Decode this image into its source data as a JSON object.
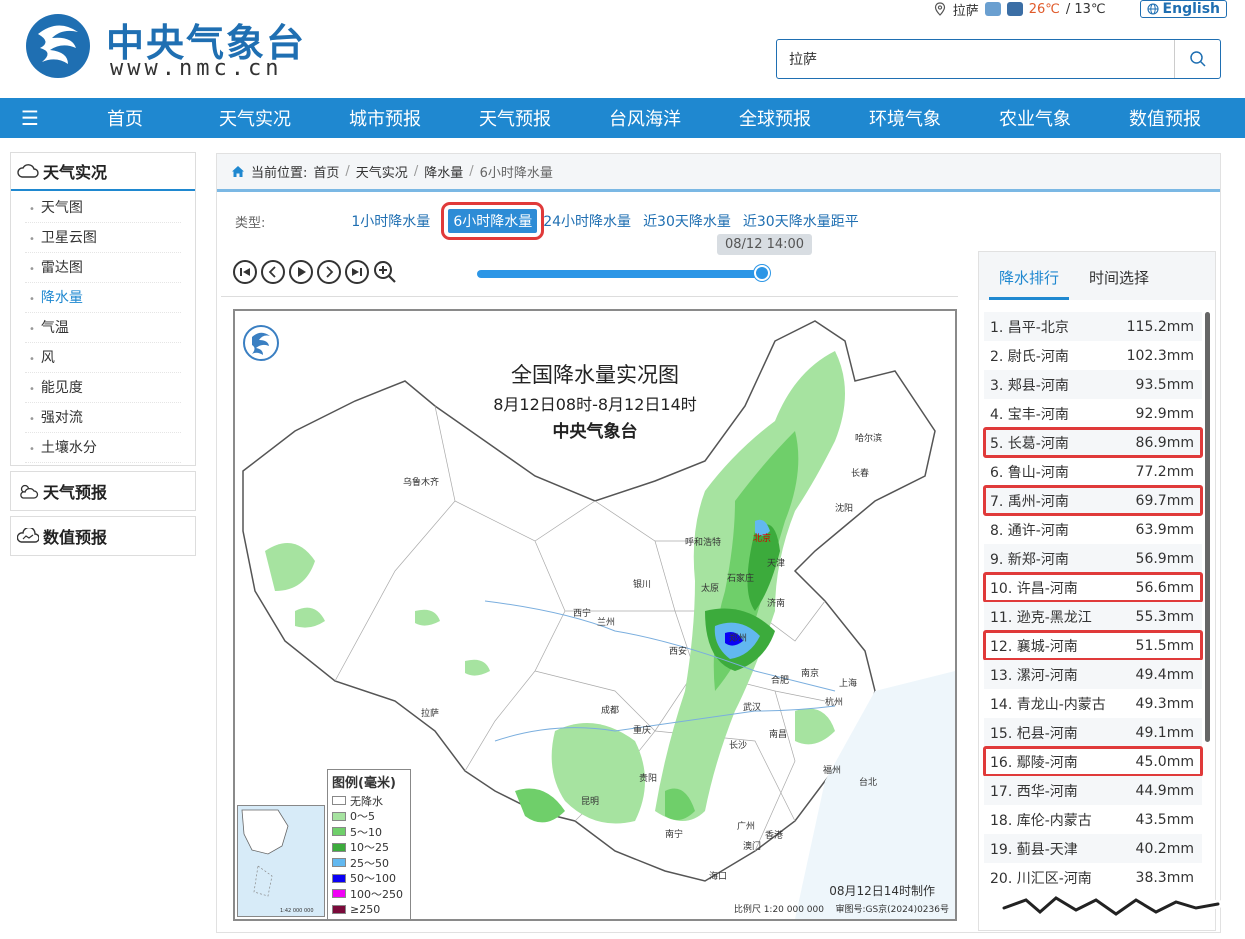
{
  "header": {
    "logo_cn": "中央气象台",
    "logo_url": "www.nmc.cn",
    "location": "拉萨",
    "temp_high": "26℃",
    "temp_low": " / 13℃",
    "english_label": "English",
    "search_value": "拉萨"
  },
  "nav": {
    "items": [
      "首页",
      "天气实况",
      "城市预报",
      "天气预报",
      "台风海洋",
      "全球预报",
      "环境气象",
      "农业气象",
      "数值预报"
    ]
  },
  "sidebar": {
    "section1": "天气实况",
    "items": [
      "天气图",
      "卫星云图",
      "雷达图",
      "降水量",
      "气温",
      "风",
      "能见度",
      "强对流",
      "土壤水分"
    ],
    "section2": "天气预报",
    "section3": "数值预报"
  },
  "breadcrumb": {
    "prefix": "当前位置:",
    "items": [
      "首页",
      "天气实况",
      "降水量",
      "6小时降水量"
    ]
  },
  "types": {
    "label": "类型:",
    "items": [
      "1小时降水量",
      "6小时降水量",
      "24小时降水量",
      "近30天降水量",
      "近30天降水量距平"
    ]
  },
  "player": {
    "timestamp": "08/12 14:00",
    "progress": 1.0
  },
  "map": {
    "title": "全国降水量实况图",
    "subtitle": "8月12日08时-8月12日14时",
    "org": "中央气象台",
    "made": "08月12日14时制作",
    "scale": "比例尺 1:20 000 000",
    "review": "审图号:GS京(2024)0236号",
    "inset_scale": "1:42 000 000",
    "cities": [
      "乌鲁木齐",
      "哈尔滨",
      "长春",
      "沈阳",
      "呼和浩特",
      "北京",
      "天津",
      "银川",
      "太原",
      "石家庄",
      "济南",
      "西宁",
      "兰州",
      "郑州",
      "西安",
      "合肥",
      "南京",
      "上海",
      "成都",
      "武汉",
      "杭州",
      "重庆",
      "长沙",
      "南昌",
      "拉萨",
      "贵阳",
      "福州",
      "台北",
      "昆明",
      "广州",
      "南宁",
      "澳门",
      "香港",
      "海口"
    ],
    "legend": {
      "title": "图例(毫米)",
      "items": [
        {
          "label": "无降水",
          "color": "#ffffff"
        },
        {
          "label": "0～5",
          "color": "#a6e3a0"
        },
        {
          "label": "5～10",
          "color": "#6fcf6a"
        },
        {
          "label": "10～25",
          "color": "#3cab3c"
        },
        {
          "label": "25～50",
          "color": "#62b8f0"
        },
        {
          "label": "50～100",
          "color": "#0a00f5"
        },
        {
          "label": "100～250",
          "color": "#f000f5"
        },
        {
          "label": "≥250",
          "color": "#7a0a3a"
        }
      ]
    }
  },
  "ranking": {
    "tab_active": "降水排行",
    "tab_other": "时间选择",
    "rows": [
      {
        "name": "1. 昌平-北京",
        "value": "115.2mm",
        "highlight": false
      },
      {
        "name": "2. 尉氏-河南",
        "value": "102.3mm",
        "highlight": false
      },
      {
        "name": "3. 郏县-河南",
        "value": "93.5mm",
        "highlight": false
      },
      {
        "name": "4. 宝丰-河南",
        "value": "92.9mm",
        "highlight": false
      },
      {
        "name": "5. 长葛-河南",
        "value": "86.9mm",
        "highlight": true
      },
      {
        "name": "6. 鲁山-河南",
        "value": "77.2mm",
        "highlight": false
      },
      {
        "name": "7. 禹州-河南",
        "value": "69.7mm",
        "highlight": true
      },
      {
        "name": "8. 通许-河南",
        "value": "63.9mm",
        "highlight": false
      },
      {
        "name": "9. 新郑-河南",
        "value": "56.9mm",
        "highlight": false
      },
      {
        "name": "10. 许昌-河南",
        "value": "56.6mm",
        "highlight": true
      },
      {
        "name": "11. 逊克-黑龙江",
        "value": "55.3mm",
        "highlight": false
      },
      {
        "name": "12. 襄城-河南",
        "value": "51.5mm",
        "highlight": true
      },
      {
        "name": "13. 漯河-河南",
        "value": "49.4mm",
        "highlight": false
      },
      {
        "name": "14. 青龙山-内蒙古",
        "value": "49.3mm",
        "highlight": false
      },
      {
        "name": "15. 杞县-河南",
        "value": "49.1mm",
        "highlight": false
      },
      {
        "name": "16. 鄢陵-河南",
        "value": "45.0mm",
        "highlight": true
      },
      {
        "name": "17. 西华-河南",
        "value": "44.9mm",
        "highlight": false
      },
      {
        "name": "18. 库伦-内蒙古",
        "value": "43.5mm",
        "highlight": false
      },
      {
        "name": "19. 蓟县-天津",
        "value": "40.2mm",
        "highlight": false
      },
      {
        "name": "20. 川汇区-河南",
        "value": "38.3mm",
        "highlight": false
      }
    ]
  },
  "colors": {
    "brand": "#1f88d0",
    "highlight": "#e03a3a"
  }
}
